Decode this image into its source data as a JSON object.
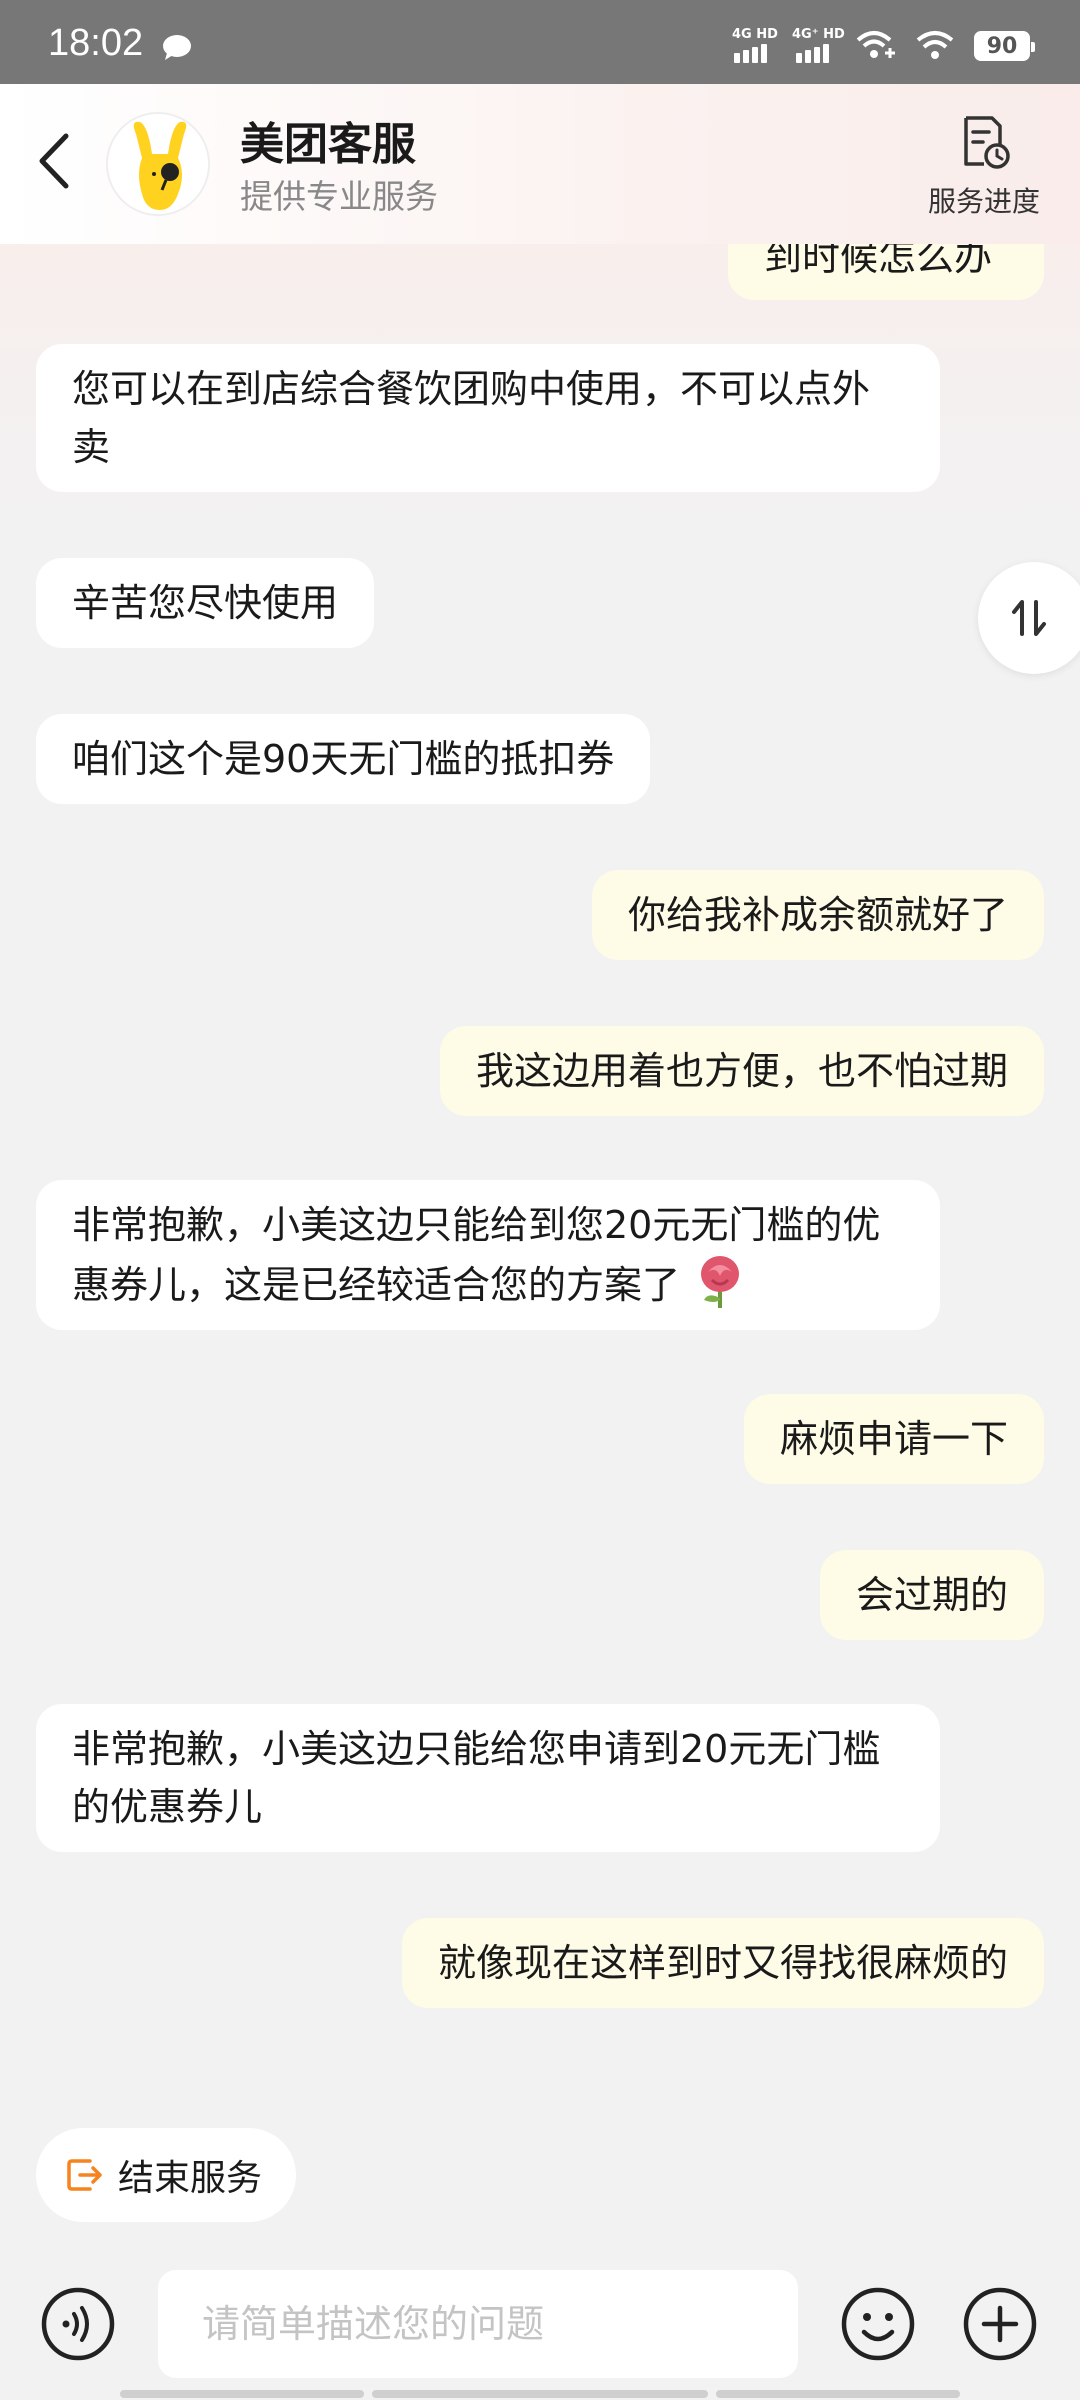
{
  "status_bar": {
    "time": "18:02",
    "network_1": "4G HD",
    "network_2": "4G⁺ HD",
    "battery": "90"
  },
  "header": {
    "title": "美团客服",
    "subtitle": "提供专业服务",
    "progress_label": "服务进度"
  },
  "messages": [
    {
      "side": "out",
      "text": "到时候怎么办"
    },
    {
      "side": "in",
      "text": "您可以在到店综合餐饮团购中使用，不可以点外卖"
    },
    {
      "side": "in",
      "text": "辛苦您尽快使用"
    },
    {
      "side": "in",
      "text": "咱们这个是90天无门槛的抵扣券"
    },
    {
      "side": "out",
      "text": "你给我补成余额就好了"
    },
    {
      "side": "out",
      "text": "我这边用着也方便，也不怕过期"
    },
    {
      "side": "in",
      "text": "非常抱歉，小美这边只能给到您20元无门槛的优惠券儿，这是已经较适合您的方案了",
      "emoji": "rose"
    },
    {
      "side": "out",
      "text": "麻烦申请一下"
    },
    {
      "side": "out",
      "text": "会过期的"
    },
    {
      "side": "in",
      "text": "非常抱歉，小美这边只能给您申请到20元无门槛的优惠券儿"
    },
    {
      "side": "out",
      "text": "就像现在这样到时又得找很麻烦的"
    }
  ],
  "end_service": {
    "label": "结束服务",
    "icon": "exit-icon"
  },
  "input": {
    "placeholder": "请简单描述您的问题",
    "value": ""
  },
  "colors": {
    "accent": "#f5841f",
    "incoming_bubble": "#ffffff",
    "outgoing_bubble": "#fefbe6",
    "status_bar": "#777777"
  }
}
